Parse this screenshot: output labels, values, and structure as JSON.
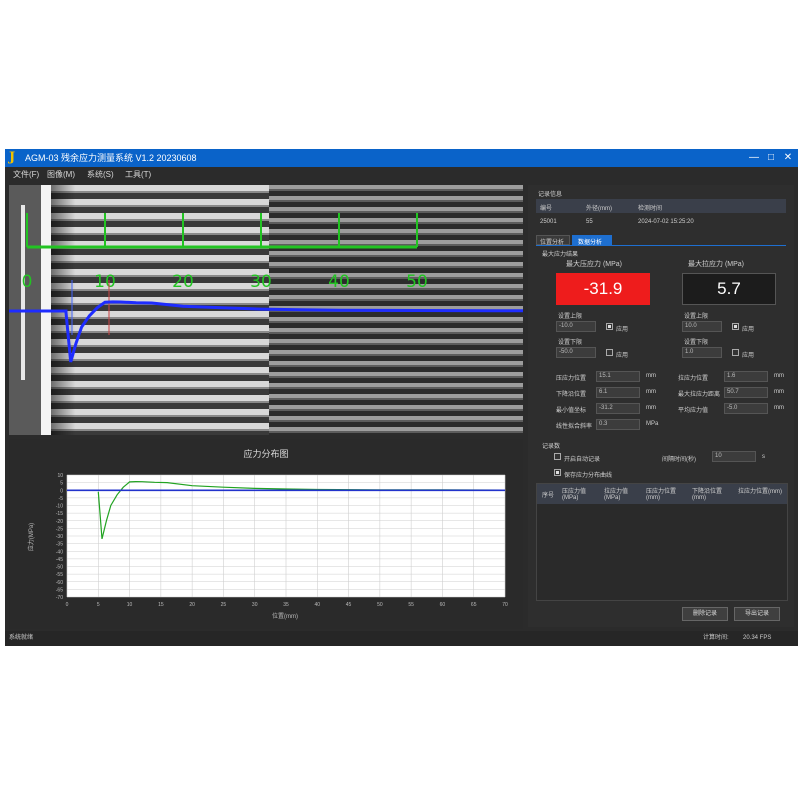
{
  "window": {
    "title": "AGM-03 残余应力测量系统 V1.2 20230608",
    "minimize": "—",
    "maximize": "□",
    "close": "✕"
  },
  "menu": [
    "文件(F)",
    "图像(M)",
    "系统(S)",
    "工具(T)"
  ],
  "image_scale": {
    "ticks": [
      "0",
      "10",
      "20",
      "30",
      "40",
      "50"
    ],
    "curve_color": "#1e2cff",
    "scale_color": "#22c422"
  },
  "stress_chart": {
    "title": "应力分布图",
    "xlabel": "位置(mm)",
    "ylabel": "应力(MPa)",
    "xticks": [
      "0",
      "5",
      "10",
      "15",
      "20",
      "25",
      "30",
      "35",
      "40",
      "45",
      "50",
      "55",
      "60",
      "65",
      "70"
    ],
    "yticks": [
      "10",
      "5",
      "0",
      "-5",
      "-10",
      "-15",
      "-20",
      "-25",
      "-30",
      "-35",
      "-40",
      "-45",
      "-50",
      "-55",
      "-60",
      "-65",
      "-70"
    ]
  },
  "chart_data": {
    "type": "line",
    "title": "应力分布图",
    "xlabel": "位置(mm)",
    "ylabel": "应力(MPa)",
    "xlim": [
      0,
      70
    ],
    "ylim": [
      -70,
      10
    ],
    "grid": true,
    "series": [
      {
        "color": "#22a322",
        "x": [
          5,
          5.6,
          6.3,
          7,
          8,
          9,
          10,
          11,
          12,
          14,
          16,
          20,
          25,
          30,
          35,
          40,
          50,
          60,
          70
        ],
        "y": [
          -1,
          -31.9,
          -20,
          -10,
          -3,
          2,
          5.5,
          5.7,
          5.6,
          5.2,
          5,
          3,
          2,
          1.2,
          0.8,
          0.5,
          0.3,
          0.2,
          0.1
        ]
      },
      {
        "color": "#2233cc",
        "x": [
          0,
          70
        ],
        "y": [
          0,
          0
        ]
      }
    ]
  },
  "right": {
    "info_group": "记录信息",
    "info_headers": [
      "编号",
      "外径(mm)",
      "检测时间"
    ],
    "info_row": [
      "25001",
      "55",
      "2024-07-02 15:25:20"
    ],
    "tabs": [
      "位置分析",
      "数据分析"
    ],
    "section_max": "最大应力结果",
    "max_comp_label": "最大压应力 (MPa)",
    "max_comp_value": "-31.9",
    "max_tens_label": "最大拉应力 (MPa)",
    "max_tens_value": "5.7",
    "upper_limit_label": "设置上限",
    "lower_limit_label": "设置下限",
    "left_upper": "-10.0",
    "right_upper": "10.0",
    "left_lower": "-50.0",
    "right_lower": "1.0",
    "apply_label": "应用",
    "params": [
      {
        "label": "压应力位置",
        "value": "15.1",
        "unit": "mm"
      },
      {
        "label": "下降沿位置",
        "value": "6.1",
        "unit": "mm"
      },
      {
        "label": "最小值坐标",
        "value": "-31.2",
        "unit": "mm"
      },
      {
        "label": "线性拟合斜率",
        "value": "0.3",
        "unit": "MPa"
      }
    ],
    "params_right": [
      {
        "label": "拉应力位置",
        "value": "1.6",
        "unit": "mm"
      },
      {
        "label": "最大拉应力距离",
        "value": "50.7",
        "unit": "mm"
      },
      {
        "label": "平均应力值",
        "value": "-5.0",
        "unit": "mm"
      }
    ],
    "record_group": "记录数",
    "auto_record_label": "开启自动记录",
    "interval_label": "间隔时间(秒)",
    "interval_value": "10",
    "interval_unit": "s",
    "save_curve_label": "保存应力分布曲线",
    "table_headers": [
      "序号",
      "压应力值(MPa)",
      "拉应力值(MPa)",
      "压应力位置(mm)",
      "下降沿位置(mm)",
      "拉应力位置(mm)"
    ],
    "btn_delete": "删除记录",
    "btn_export": "导出记录"
  },
  "status": {
    "left": "系统就绪",
    "right_label": "计算时间:",
    "right_value": "20.34 FPS"
  }
}
